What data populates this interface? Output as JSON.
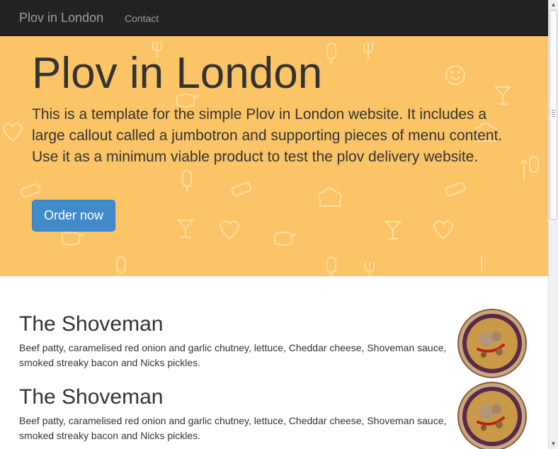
{
  "navbar": {
    "brand": "Plov in London",
    "links": [
      "Contact"
    ]
  },
  "jumbotron": {
    "title": "Plov in London",
    "text": "This is a template for the simple Plov in London website. It includes a large callout called a jumbotron and supporting pieces of menu content. Use it as a minimum viable product to test the plov delivery website.",
    "button_label": "Order now"
  },
  "menu": [
    {
      "title": "The Shoveman",
      "description": "Beef patty, caramelised red onion and garlic chutney, lettuce, Cheddar cheese, Shoveman sauce, smoked streaky bacon and Nicks pickles.",
      "image": "plov-dish-image"
    },
    {
      "title": "The Shoveman",
      "description": "Beef patty, caramelised red onion and garlic chutney, lettuce, Cheddar cheese, Shoveman sauce, smoked streaky bacon and Nicks pickles.",
      "image": "plov-dish-image"
    }
  ],
  "colors": {
    "navbar_bg": "#222222",
    "jumbotron_bg": "#fbc466",
    "button_bg": "#428bca",
    "nav_text": "#9d9d9d"
  }
}
